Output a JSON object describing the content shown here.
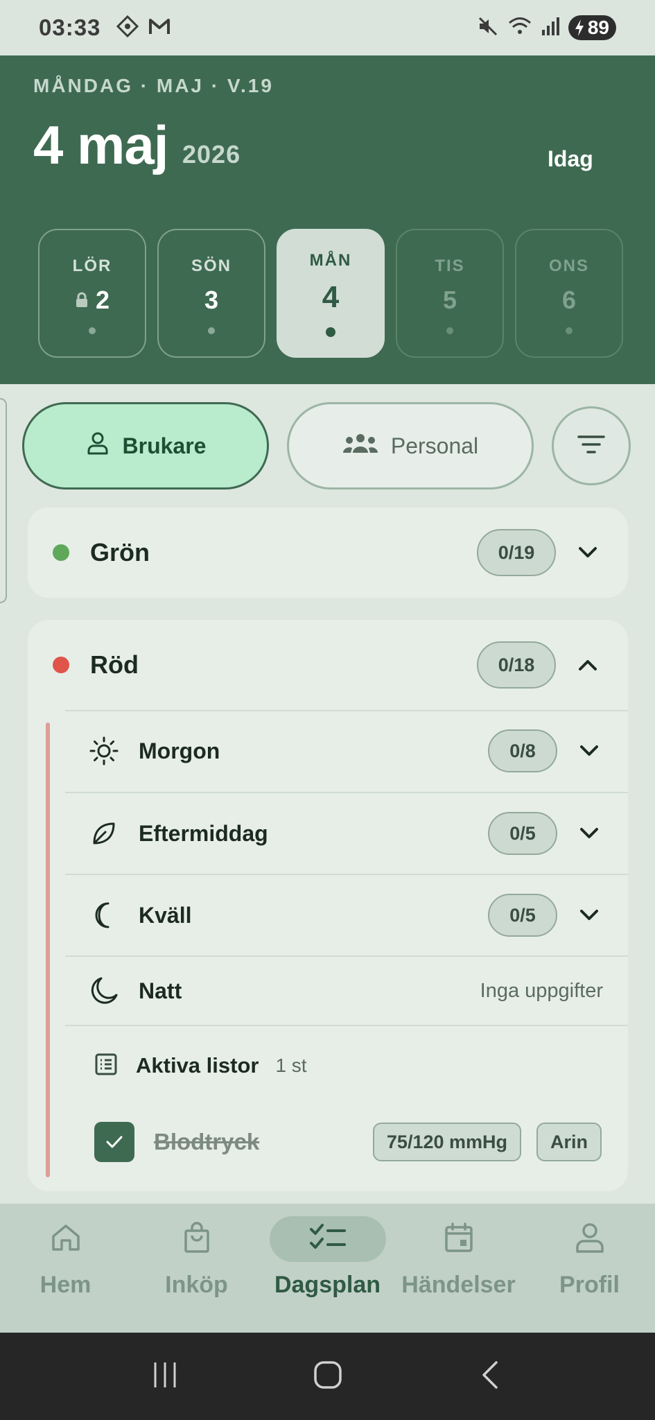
{
  "status_bar": {
    "time": "03:33",
    "battery": "89"
  },
  "header": {
    "date_line": "MÅNDAG · MAJ · V.19",
    "big_date": "4 maj",
    "year": "2026",
    "today_button": "Idag"
  },
  "days": [
    {
      "name": "LÖR",
      "num": "2",
      "state": "locked"
    },
    {
      "name": "SÖN",
      "num": "3",
      "state": "past"
    },
    {
      "name": "MÅN",
      "num": "4",
      "state": "active"
    },
    {
      "name": "TIS",
      "num": "5",
      "state": "future"
    },
    {
      "name": "ONS",
      "num": "6",
      "state": "future"
    }
  ],
  "toggles": {
    "brukare": "Brukare",
    "personal": "Personal"
  },
  "groups": {
    "gron": {
      "name": "Grön",
      "count": "0/19",
      "color": "#5fa85a"
    },
    "rod": {
      "name": "Röd",
      "count": "0/18",
      "color": "#e0544a"
    }
  },
  "subgroups": {
    "morgon": {
      "name": "Morgon",
      "count": "0/8"
    },
    "eftermiddag": {
      "name": "Eftermiddag",
      "count": "0/5"
    },
    "kvall": {
      "name": "Kväll",
      "count": "0/5"
    },
    "natt": {
      "name": "Natt",
      "empty_text": "Inga uppgifter"
    }
  },
  "active_lists": {
    "title": "Aktiva listor",
    "count": "1 st"
  },
  "list_item": {
    "name": "Blodtryck",
    "value": "75/120 mmHg",
    "person": "Arin",
    "checked": true
  },
  "nav": {
    "home": "Hem",
    "purchase": "Inköp",
    "dayplan": "Dagsplan",
    "events": "Händelser",
    "profile": "Profil"
  },
  "colors": {
    "header_bg": "#3f6a52",
    "accent": "#b9ebcd"
  }
}
